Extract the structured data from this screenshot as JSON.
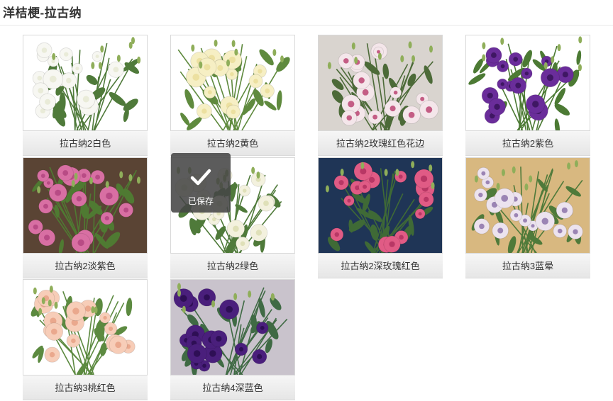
{
  "header": {
    "title": "洋桔梗-拉古纳"
  },
  "toast": {
    "label": "已保存",
    "icon": "checkmark-icon"
  },
  "items": [
    {
      "caption": "拉古纳2白色",
      "petal": "#f7f7f2",
      "center": "#e9ebd8",
      "bg": "#ffffff",
      "leaf": "#4f7a3a"
    },
    {
      "caption": "拉古纳2黄色",
      "petal": "#f6efc4",
      "center": "#ece0a0",
      "bg": "#ffffff",
      "leaf": "#5f8a3e"
    },
    {
      "caption": "拉古纳2玫瑰红色花边",
      "petal": "#f4e6ea",
      "center": "#c45d85",
      "bg": "#d9d4cf",
      "leaf": "#4c6a38"
    },
    {
      "caption": "拉古纳2紫色",
      "petal": "#6a2d9a",
      "center": "#3f1763",
      "bg": "#ffffff",
      "leaf": "#4c7a34"
    },
    {
      "caption": "拉古纳2淡紫色",
      "petal": "#d86fa3",
      "center": "#b84b85",
      "bg": "#5a4434",
      "leaf": "#4f7a32"
    },
    {
      "caption": "拉古纳2绿色",
      "petal": "#f3f1de",
      "center": "#dfe0b8",
      "bg": "#ffffff",
      "leaf": "#4f7a3a"
    },
    {
      "caption": "拉古纳2深玫瑰红色",
      "petal": "#e05b85",
      "center": "#b83765",
      "bg": "#1f3556",
      "leaf": "#3f6a36"
    },
    {
      "caption": "拉古纳3蓝晕",
      "petal": "#ece3ee",
      "center": "#9b84b4",
      "bg": "#d8b880",
      "leaf": "#4f7a3a"
    },
    {
      "caption": "拉古纳3桃红色",
      "petal": "#f7cdb8",
      "center": "#eaa88d",
      "bg": "#ffffff",
      "leaf": "#5c8a40"
    },
    {
      "caption": "拉古纳4深蓝色",
      "petal": "#4a1f7c",
      "center": "#2e0f55",
      "bg": "#c9c3cc",
      "leaf": "#3f6a44"
    }
  ]
}
